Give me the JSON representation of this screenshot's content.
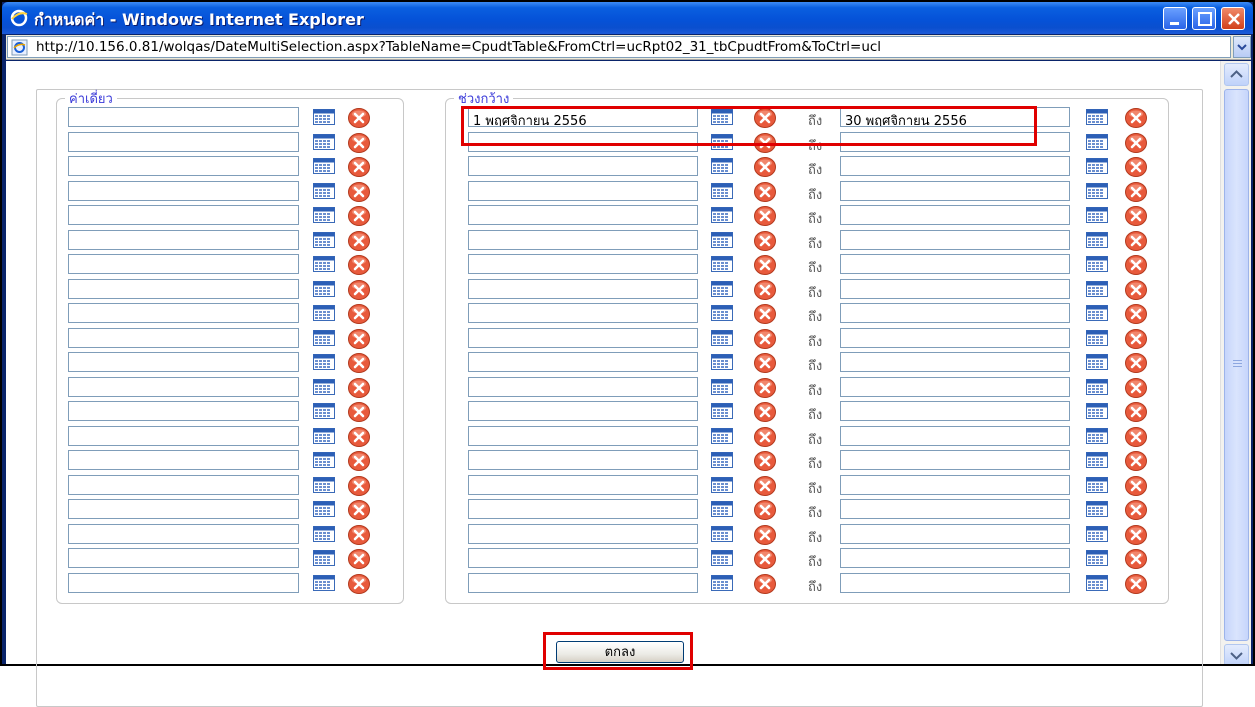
{
  "window": {
    "title": "กำหนดค่า - Windows Internet Explorer",
    "address": "http://10.156.0.81/wolqas/DateMultiSelection.aspx?TableName=CpudtTable&FromCtrl=ucRpt02_31_tbCpudtFrom&ToCtrl=ucl"
  },
  "single": {
    "legend": "ค่าเดี่ยว",
    "rows": [
      "",
      "",
      "",
      "",
      "",
      "",
      "",
      "",
      "",
      "",
      "",
      "",
      "",
      "",
      "",
      "",
      "",
      "",
      "",
      ""
    ]
  },
  "range": {
    "legend": "ช่วงกว้าง",
    "to_label": "ถึง",
    "rows": [
      {
        "from": "1 พฤศจิกายน 2556",
        "to": "30 พฤศจิกายน 2556"
      },
      {
        "from": "",
        "to": ""
      },
      {
        "from": "",
        "to": ""
      },
      {
        "from": "",
        "to": ""
      },
      {
        "from": "",
        "to": ""
      },
      {
        "from": "",
        "to": ""
      },
      {
        "from": "",
        "to": ""
      },
      {
        "from": "",
        "to": ""
      },
      {
        "from": "",
        "to": ""
      },
      {
        "from": "",
        "to": ""
      },
      {
        "from": "",
        "to": ""
      },
      {
        "from": "",
        "to": ""
      },
      {
        "from": "",
        "to": ""
      },
      {
        "from": "",
        "to": ""
      },
      {
        "from": "",
        "to": ""
      },
      {
        "from": "",
        "to": ""
      },
      {
        "from": "",
        "to": ""
      },
      {
        "from": "",
        "to": ""
      },
      {
        "from": "",
        "to": ""
      },
      {
        "from": "",
        "to": ""
      }
    ]
  },
  "ok_button": "ตกลง",
  "colors": {
    "highlight": "#e00000",
    "legend": "#3b3bd9",
    "title_bar": "#0552d8"
  },
  "icons": {
    "calendar": "calendar-icon",
    "clear": "clear-icon",
    "ie": "ie-logo-icon"
  }
}
